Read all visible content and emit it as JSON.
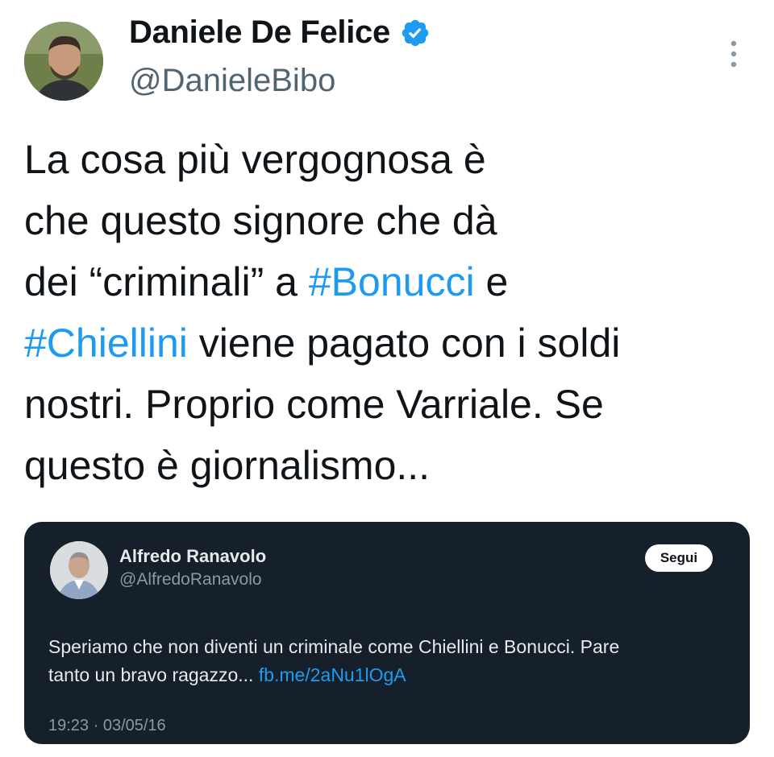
{
  "author": {
    "name": "Daniele De Felice",
    "handle": "@DanieleBibo",
    "verified": true,
    "avatar_icon": "profile-photo-man-beard"
  },
  "more_icon": "vertical-dots-icon",
  "tweet": {
    "lines": [
      [
        {
          "text": "La cosa più vergognosa è"
        }
      ],
      [
        {
          "text": "che questo signore che dà"
        }
      ],
      [
        {
          "text": "dei “criminali” a "
        },
        {
          "text": "#Bonucci",
          "hashtag": true
        },
        {
          "text": " e"
        }
      ],
      [
        {
          "text": "#Chiellini",
          "hashtag": true
        },
        {
          "text": " viene pagato con i soldi"
        }
      ],
      [
        {
          "text": "nostri. Proprio come Varriale. Se"
        }
      ],
      [
        {
          "text": "questo è giornalismo..."
        }
      ]
    ]
  },
  "quoted": {
    "name": "Alfredo Ranavolo",
    "handle": "@AlfredoRanavolo",
    "follow_label": "Segui",
    "text_line1": "Speriamo che non diventi un criminale come Chiellini e Bonucci. Pare",
    "text_line2": "tanto un bravo ragazzo... ",
    "link": "fb.me/2aNu1lOgA",
    "timestamp": "19:23 · 03/05/16"
  },
  "colors": {
    "accent": "#1d9bf0",
    "quote_background": "#15202b"
  }
}
